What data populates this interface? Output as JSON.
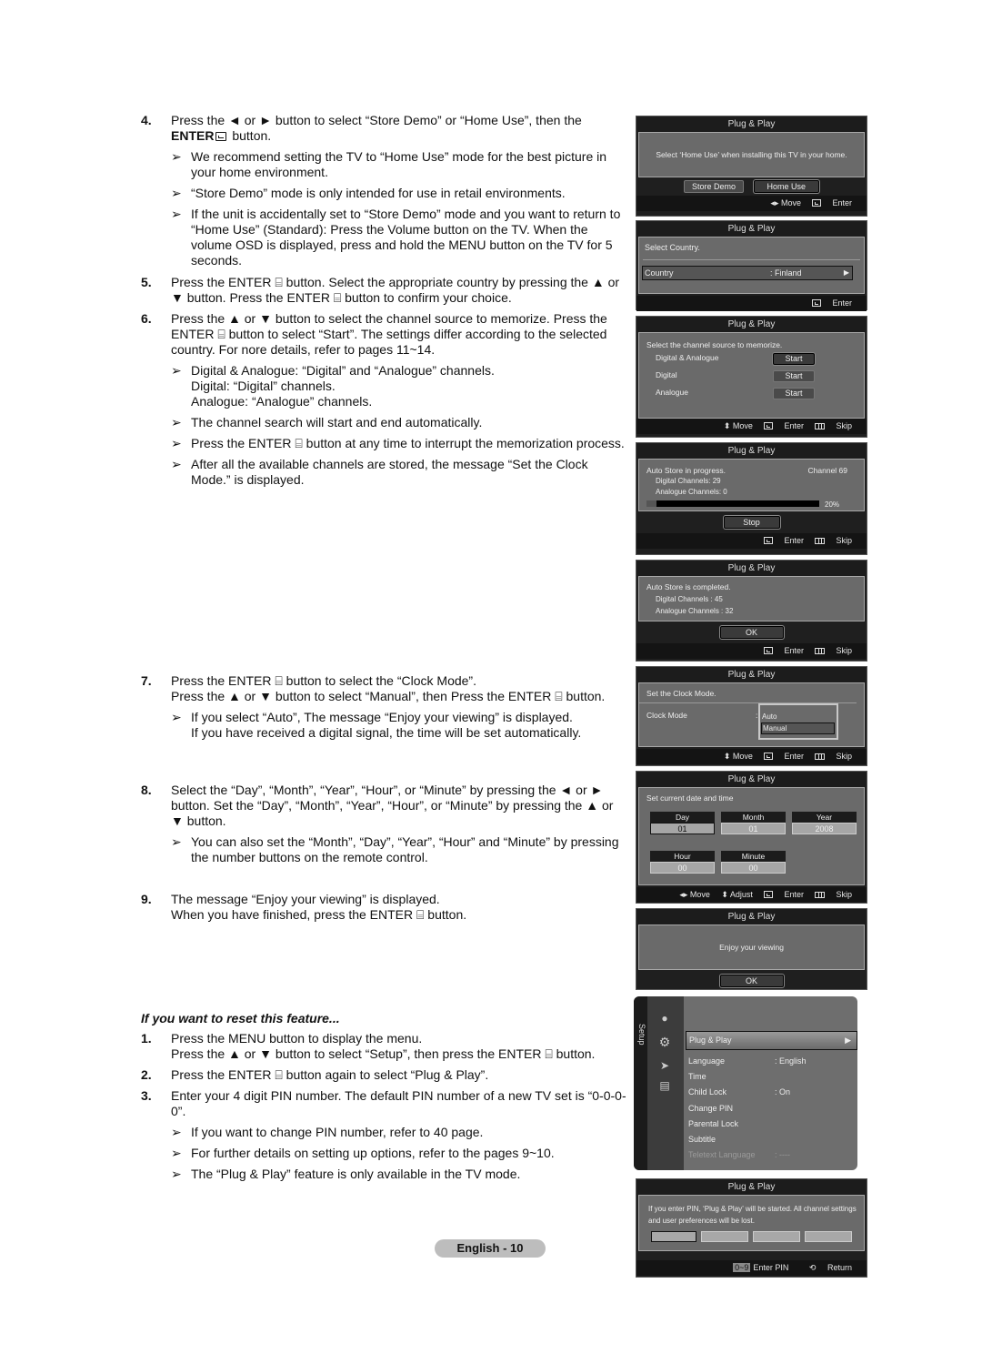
{
  "instructions": {
    "step4": {
      "num": "4.",
      "text_a": "Press the ◄ or ► button to select “Store Demo” or “Home Use”, then the",
      "enter": "ENTER",
      "text_b": "button.",
      "notes": [
        "We recommend setting the TV to “Home Use” mode for the best picture in your home environment.",
        "“Store Demo” mode is only intended for use in retail environments.",
        "If the unit is accidentally set to “Store Demo” mode and you want to return to “Home Use” (Standard): Press the Volume button on the TV. When the volume OSD is displayed, press and hold the MENU button on the TV for 5 seconds."
      ]
    },
    "step5": {
      "num": "5.",
      "text": "Press the ENTER ⌸ button. Select the appropriate country by pressing the ▲ or ▼ button. Press the ENTER ⌸ button to confirm your choice."
    },
    "step6": {
      "num": "6.",
      "text": "Press the ▲ or ▼ button to select the channel source to memorize. Press the ENTER ⌸ button to select “Start”. The settings differ according to the selected country. For nore details, refer to pages 11~14.",
      "notes": [
        "Digital & Analogue: “Digital” and “Analogue” channels.",
        "Digital: “Digital” channels.",
        "Analogue: “Analogue” channels.",
        "The channel search will start and end automatically.",
        "Press the ENTER ⌸ button at any time to interrupt the memorization process.",
        "After all the available channels are stored, the message “Set the Clock Mode.” is displayed."
      ]
    },
    "step7": {
      "num": "7.",
      "line1": "Press the ENTER ⌸ button to select the “Clock Mode”.",
      "line2": "Press the ▲ or ▼ button to select “Manual”, then Press the ENTER ⌸ button.",
      "notes": [
        "If you select “Auto”, The message “Enjoy your viewing” is displayed.",
        "If you have received a digital signal, the time will be set automatically."
      ]
    },
    "step8": {
      "num": "8.",
      "text": "Select the “Day”, “Month”, “Year”, “Hour”, or “Minute” by pressing the ◄ or ► button. Set the “Day”, “Month”, “Year”, “Hour”, or “Minute” by pressing the ▲ or ▼ button.",
      "notes": [
        "You can also set the “Month”, “Day”, “Year”, “Hour” and “Minute” by pressing the number buttons on the remote control."
      ]
    },
    "step9": {
      "num": "9.",
      "line1": "The message “Enjoy your viewing” is displayed.",
      "line2": "When you have finished, press the ENTER ⌸ button."
    },
    "reset": {
      "heading": "If you want to reset this feature...",
      "steps": [
        {
          "num": "1.",
          "line1": "Press the MENU button to display the menu.",
          "line2": "Press the ▲ or ▼ button to select “Setup”, then press the ENTER ⌸ button."
        },
        {
          "num": "2.",
          "line1": "Press the ENTER ⌸ button again to select “Plug & Play”."
        },
        {
          "num": "3.",
          "line1": "Enter your 4 digit PIN number. The default PIN number of a new TV set is “0-0-0-0”."
        }
      ],
      "notes": [
        "If you want to change PIN number, refer to 40 page.",
        "For further details on setting up options, refer to the pages 9~10.",
        "The “Plug & Play” feature is only available in the TV mode."
      ]
    },
    "note_arrow": "➢",
    "page_label": "English - 10"
  },
  "screens": {
    "title": "Plug & Play",
    "home_use": {
      "message": "Select ‘Home Use’ when installing this TV in your home.",
      "buttons": [
        "Store Demo",
        "Home Use"
      ],
      "footer": [
        "◂▸ Move",
        "Enter"
      ]
    },
    "country": {
      "message": "Select Country.",
      "label": "Country",
      "value": ": Finland",
      "footer": [
        "Enter"
      ]
    },
    "source": {
      "message": "Select the channel source to memorize.",
      "rows": [
        {
          "label": "Digital & Analogue",
          "button": "Start"
        },
        {
          "label": "Digital",
          "button": "Start"
        },
        {
          "label": "Analogue",
          "button": "Start"
        }
      ],
      "footer": [
        "⬍ Move",
        "Enter",
        "Skip"
      ]
    },
    "progress": {
      "message": "Auto Store in progress.",
      "channel": "Channel 69",
      "digital": "Digital Channels: 29",
      "analogue": "Analogue Channels: 0",
      "percent_label": "20%",
      "progress_fraction": 0.06,
      "button": "Stop",
      "footer": [
        "Enter",
        "Skip"
      ]
    },
    "completed": {
      "message": "Auto Store is completed.",
      "digital": "Digital Channels : 45",
      "analogue": "Analogue Channels : 32",
      "button": "OK",
      "footer": [
        "Enter",
        "Skip"
      ]
    },
    "clock_mode": {
      "message": "Set the Clock Mode.",
      "label": "Clock Mode",
      "options": [
        "Auto",
        "Manual"
      ],
      "selected": "Manual",
      "footer": [
        "⬍ Move",
        "Enter",
        "Skip"
      ]
    },
    "date_time": {
      "message": "Set current  date and time",
      "fields": [
        {
          "label": "Day",
          "value": "01"
        },
        {
          "label": "Month",
          "value": "01"
        },
        {
          "label": "Year",
          "value": "2008"
        },
        {
          "label": "Hour",
          "value": "00"
        },
        {
          "label": "Minute",
          "value": "00"
        }
      ],
      "footer": [
        "◂▸ Move",
        "⬍ Adjust",
        "Enter",
        "Skip"
      ]
    },
    "enjoy": {
      "message": "Enjoy your viewing",
      "button": "OK"
    },
    "setup_menu": {
      "tab": "Setup",
      "items": [
        {
          "label": "Plug & Play",
          "value": ""
        },
        {
          "label": "Language",
          "value": ": English"
        },
        {
          "label": "Time",
          "value": ""
        },
        {
          "label": "Child Lock",
          "value": ": On"
        },
        {
          "label": "Change PIN",
          "value": ""
        },
        {
          "label": "Parental Lock",
          "value": ""
        },
        {
          "label": "Subtitle",
          "value": ""
        },
        {
          "label": "Teletext Language",
          "value": ": ----"
        }
      ]
    },
    "pin": {
      "message": "If you enter PIN, ‘Plug & Play’ will be started. All channel settings and user preferences will be lost.",
      "keys": "0~9",
      "footer_enter": "Enter PIN",
      "footer_return": "Return"
    }
  }
}
